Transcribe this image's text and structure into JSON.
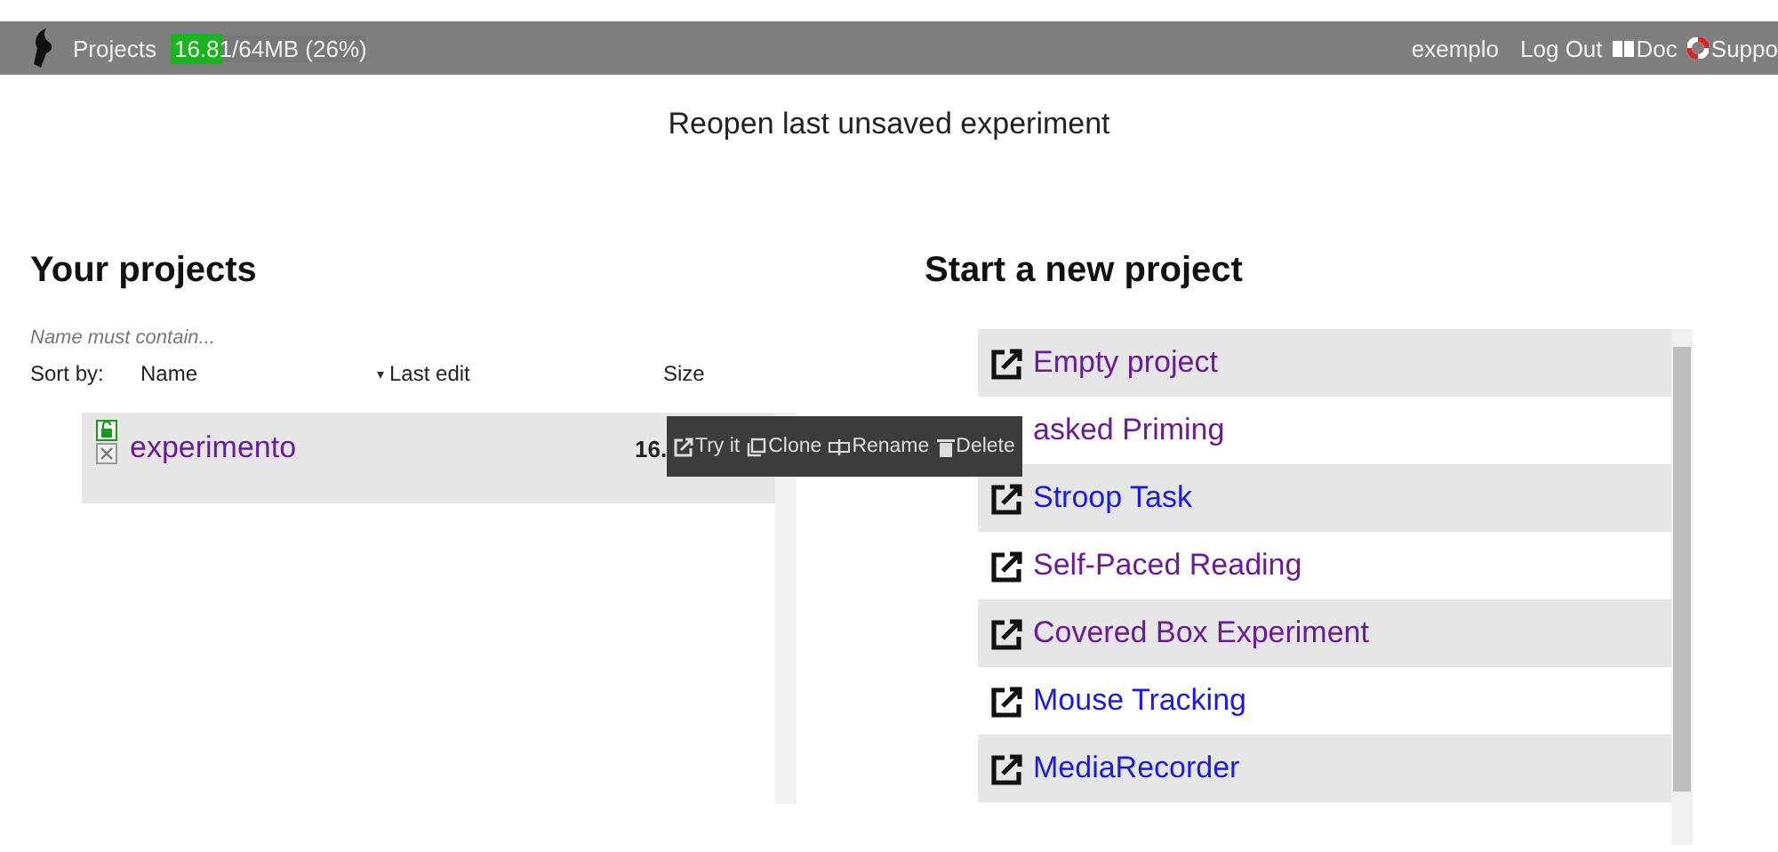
{
  "topbar": {
    "projects_label": "Projects",
    "memory": {
      "level": 0.26,
      "text": "16.81/64MB (26%)"
    },
    "user": "exemplo",
    "logout": "Log Out",
    "doc": "Doc",
    "support": "Suppo"
  },
  "reopen": "Reopen last unsaved experiment",
  "your_projects": {
    "title": "Your projects",
    "filter_placeholder": "Name must contain...",
    "sort_label": "Sort by:",
    "columns": [
      {
        "label": "Name",
        "sorted": false
      },
      {
        "label": "Last edit",
        "sorted": true
      },
      {
        "label": "Size",
        "sorted": false
      }
    ],
    "projects": [
      {
        "name": "experimento",
        "unlocked": true,
        "size": "16.",
        "visited": true,
        "actions": [
          "Try it",
          "Clone",
          "Rename",
          "Delete"
        ]
      }
    ]
  },
  "new_project": {
    "title": "Start a new project",
    "templates": [
      {
        "name": "Empty project",
        "visited": true,
        "icon_visible": true
      },
      {
        "name": "asked Priming",
        "visited": true,
        "icon_visible": false
      },
      {
        "name": "Stroop Task",
        "visited": false,
        "icon_visible": true
      },
      {
        "name": "Self-Paced Reading",
        "visited": true,
        "icon_visible": true
      },
      {
        "name": "Covered Box Experiment",
        "visited": true,
        "icon_visible": true
      },
      {
        "name": "Mouse Tracking",
        "visited": false,
        "icon_visible": true
      },
      {
        "name": "MediaRecorder",
        "visited": false,
        "icon_visible": true
      }
    ]
  }
}
